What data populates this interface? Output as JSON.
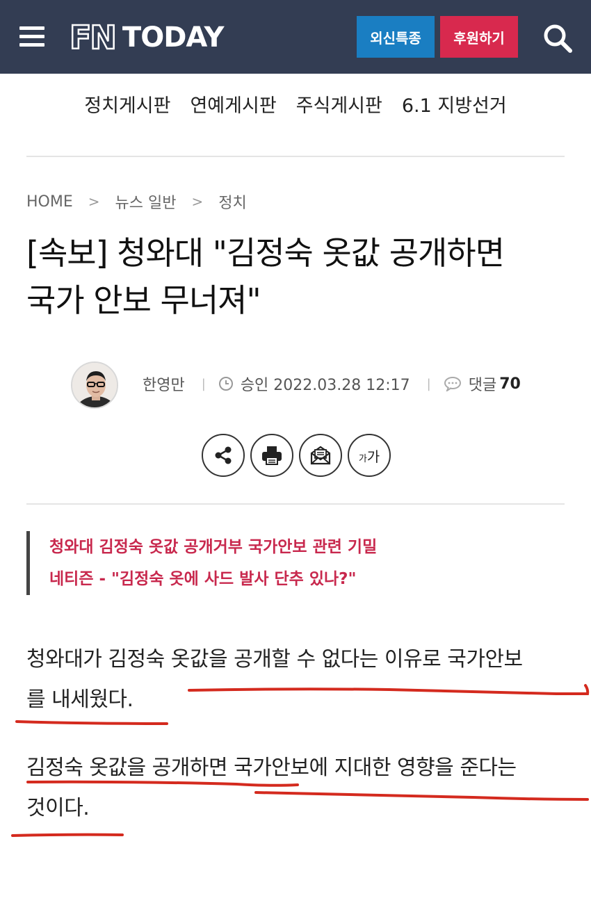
{
  "header": {
    "logo_fn": "FN",
    "logo_today": "TODAY",
    "btn_special": "외신특종",
    "btn_support": "후원하기",
    "colors": {
      "bar": "#333d53",
      "special": "#1a7ec2",
      "support": "#d8294e"
    }
  },
  "subnav": [
    "정치게시판",
    "연예게시판",
    "주식게시판",
    "6.1 지방선거"
  ],
  "breadcrumb": [
    "HOME",
    "뉴스 일반",
    "정치"
  ],
  "article": {
    "headline_line1": "[속보] 청와대 \"김정숙 옷값 공개하면",
    "headline_line2": "국가 안보 무너져\"",
    "author": "한영만",
    "approved": "승인 2022.03.28 12:17",
    "comments_label": "댓글",
    "comments_count": "70",
    "subhead_line1": "청와대 김정숙 옷값 공개거부 국가안보 관련 기밀",
    "subhead_line2": "네티즌 - \"김정숙 옷에 사드 발사 단추 있나?\"",
    "subhead_color": "#c8284d",
    "para1_line1": "청와대가 김정숙 옷값을 공개할 수 없다는 이유로 국가안보",
    "para1_line2": "를 내세웠다.",
    "para2_line1": "김정숙 옷값을 공개하면 국가안보에 지대한 영향을 준다는",
    "para2_line2": "것이다.",
    "font_size_toggle": "가가"
  },
  "annotation_color": "#d42a1e"
}
